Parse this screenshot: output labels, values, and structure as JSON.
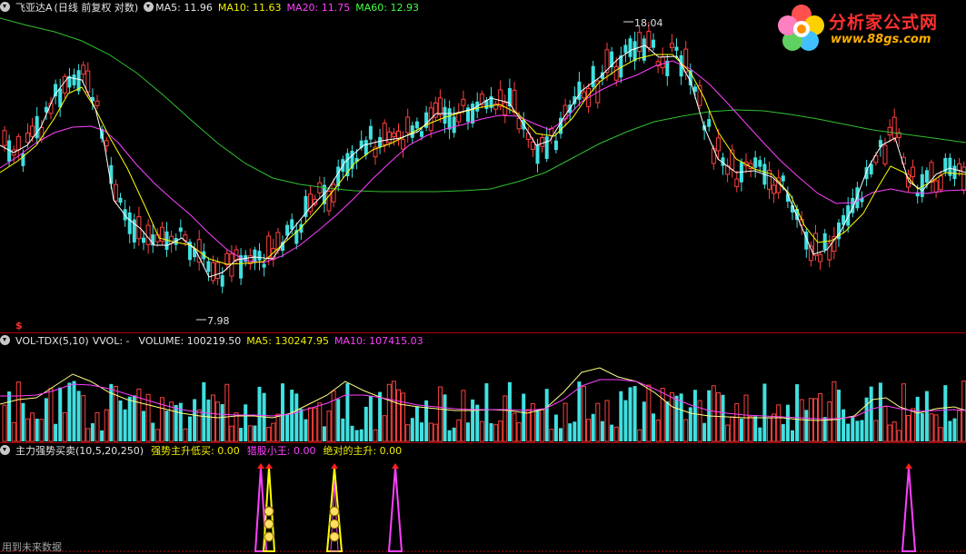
{
  "panels": {
    "price": {
      "title": "飞亚达A",
      "mode": "(日线 前复权 对数)",
      "ma5": "MA5: 11.96",
      "ma10": "MA10: 11.63",
      "ma20": "MA20: 11.75",
      "ma60": "MA60: 12.93",
      "high_label": "18.04",
      "low_label": "7.98",
      "marker": "$"
    },
    "volume": {
      "title": "VOL-TDX(5,10)",
      "vvol": "VVOL: -",
      "volume": "VOLUME: 100219.50",
      "ma5": "MA5: 130247.95",
      "ma10": "MA10: 107415.03"
    },
    "indicator": {
      "title": "主力强势买卖(10,5,20,250)",
      "strong": "强势主升低买: 0.00",
      "hunter": "猎股小王: 0.00",
      "absolute": "绝对的主升: 0.00",
      "future": "用到未来数据"
    }
  },
  "logo": {
    "title": "分析家公式网",
    "url": "www.88gs.com"
  },
  "colors": {
    "up": "#ff4040",
    "down": "#40e0e0",
    "ma5": "#ffffff",
    "ma10": "#ffff00",
    "ma20": "#ff40ff",
    "ma60": "#30c030",
    "divider": "#b00000"
  }
}
